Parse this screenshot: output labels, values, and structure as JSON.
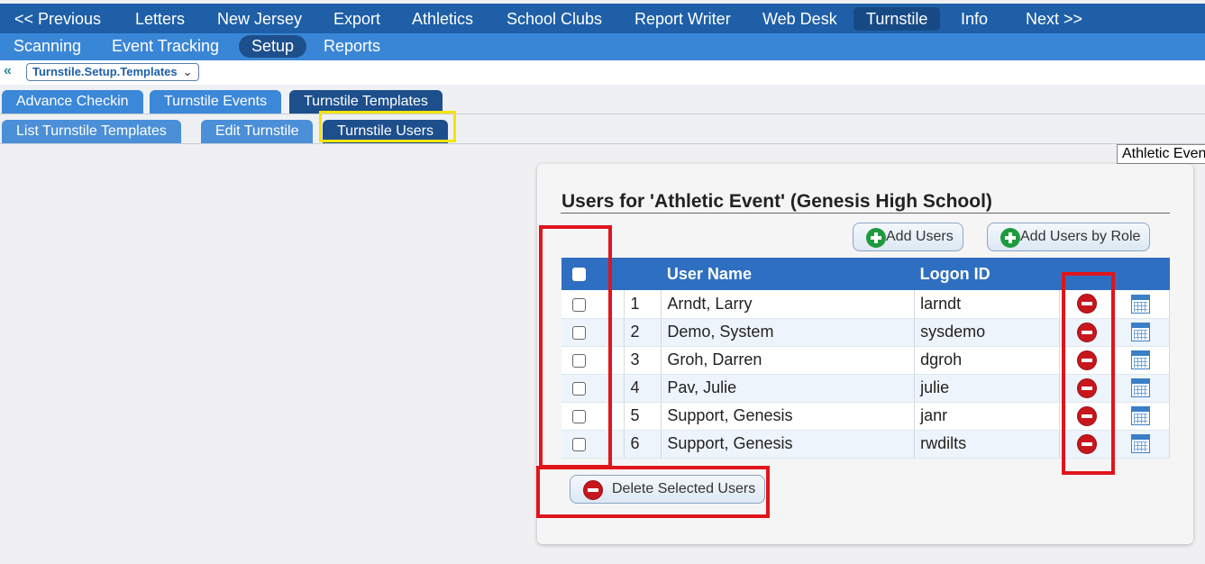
{
  "nav_primary": [
    {
      "label": "<< Previous",
      "active": false
    },
    {
      "label": "Letters",
      "active": false
    },
    {
      "label": "New Jersey",
      "active": false
    },
    {
      "label": "Export",
      "active": false
    },
    {
      "label": "Athletics",
      "active": false
    },
    {
      "label": "School Clubs",
      "active": false
    },
    {
      "label": "Report Writer",
      "active": false
    },
    {
      "label": "Web Desk",
      "active": false
    },
    {
      "label": "Turnstile",
      "active": true
    },
    {
      "label": "Info",
      "active": false
    },
    {
      "label": "Next >>",
      "active": false
    }
  ],
  "nav_secondary": [
    {
      "label": "Scanning",
      "active": false
    },
    {
      "label": "Event Tracking",
      "active": false
    },
    {
      "label": "Setup",
      "active": true
    },
    {
      "label": "Reports",
      "active": false
    }
  ],
  "breadcrumb": {
    "label": "Turnstile.Setup.Templates",
    "chevron": "⌄",
    "collapse_glyph": "«"
  },
  "tabs_row1": [
    {
      "label": "Advance Checkin",
      "active": false
    },
    {
      "label": "Turnstile Events",
      "active": false
    },
    {
      "label": "Turnstile Templates",
      "active": true
    }
  ],
  "tabs_row2": [
    {
      "label": "List Turnstile Templates",
      "active": false
    },
    {
      "label": "Edit Turnstile",
      "active": false
    },
    {
      "label": "Turnstile Users",
      "active": true
    }
  ],
  "event_selector": {
    "value": "Athletic Event"
  },
  "panel": {
    "title": "Users for 'Athletic Event' (Genesis High School)",
    "add_users_label": "Add Users",
    "add_users_by_role_label": "Add Users by Role",
    "delete_selected_label": "Delete Selected Users"
  },
  "table": {
    "columns": [
      "",
      "",
      "User Name",
      "Logon ID",
      "",
      ""
    ],
    "rows": [
      {
        "num": "1",
        "name": "Arndt, Larry",
        "logon": "larndt"
      },
      {
        "num": "2",
        "name": "Demo, System",
        "logon": "sysdemo"
      },
      {
        "num": "3",
        "name": "Groh, Darren",
        "logon": "dgroh"
      },
      {
        "num": "4",
        "name": "Pav, Julie",
        "logon": "julie"
      },
      {
        "num": "5",
        "name": "Support, Genesis",
        "logon": "janr"
      },
      {
        "num": "6",
        "name": "Support, Genesis",
        "logon": "rwdilts"
      }
    ]
  },
  "colors": {
    "nav_primary_bg": "#1e5fa8",
    "nav_secondary_bg": "#3a86d6",
    "table_header_bg": "#2f6fc1",
    "annotation_red": "#e0151b",
    "annotation_yellow": "#f5e400"
  }
}
